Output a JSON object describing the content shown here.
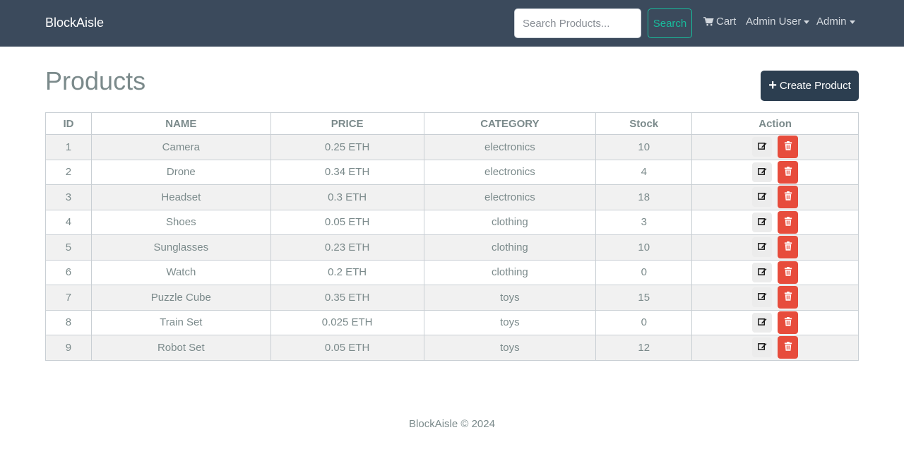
{
  "navbar": {
    "brand": "BlockAisle",
    "search_placeholder": "Search Products...",
    "search_label": "Search",
    "cart_label": "Cart",
    "user_label": "Admin User",
    "admin_label": "Admin"
  },
  "page": {
    "title": "Products",
    "create_label": "Create Product"
  },
  "table": {
    "headers": [
      "ID",
      "NAME",
      "PRICE",
      "CATEGORY",
      "Stock",
      "Action"
    ],
    "rows": [
      {
        "id": "1",
        "name": "Camera",
        "price": "0.25 ETH",
        "category": "electronics",
        "stock": "10"
      },
      {
        "id": "2",
        "name": "Drone",
        "price": "0.34 ETH",
        "category": "electronics",
        "stock": "4"
      },
      {
        "id": "3",
        "name": "Headset",
        "price": "0.3 ETH",
        "category": "electronics",
        "stock": "18"
      },
      {
        "id": "4",
        "name": "Shoes",
        "price": "0.05 ETH",
        "category": "clothing",
        "stock": "3"
      },
      {
        "id": "5",
        "name": "Sunglasses",
        "price": "0.23 ETH",
        "category": "clothing",
        "stock": "10"
      },
      {
        "id": "6",
        "name": "Watch",
        "price": "0.2 ETH",
        "category": "clothing",
        "stock": "0"
      },
      {
        "id": "7",
        "name": "Puzzle Cube",
        "price": "0.35 ETH",
        "category": "toys",
        "stock": "15"
      },
      {
        "id": "8",
        "name": "Train Set",
        "price": "0.025 ETH",
        "category": "toys",
        "stock": "0"
      },
      {
        "id": "9",
        "name": "Robot Set",
        "price": "0.05 ETH",
        "category": "toys",
        "stock": "12"
      }
    ]
  },
  "footer": {
    "text": "BlockAisle © 2024"
  },
  "icons": {
    "cart": "cart-icon",
    "plus": "plus-icon",
    "edit": "edit-icon",
    "delete": "trash-icon"
  },
  "colors": {
    "navbar": "#3b4a5c",
    "accent": "#18bc9c",
    "primary": "#2c3e50",
    "danger": "#e74c3c"
  }
}
